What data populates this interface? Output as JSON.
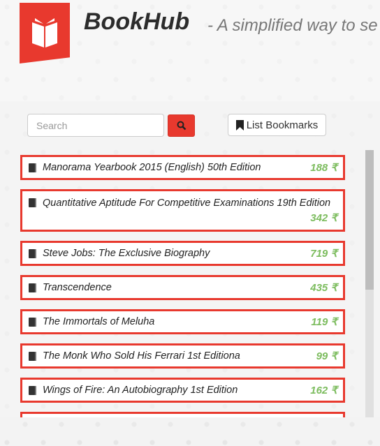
{
  "header": {
    "title": "BookHub",
    "subtitle": "- A simplified way to se"
  },
  "search": {
    "placeholder": "Search",
    "value": ""
  },
  "toolbar": {
    "bookmarks_label": "List Bookmarks"
  },
  "colors": {
    "accent": "#e8392e",
    "price": "#7cbc5e"
  },
  "books": [
    {
      "name": "Manorama Yearbook 2015 (English) 50th Edition",
      "price": "188 ₹"
    },
    {
      "name": "Quantitative Aptitude For Competitive Examinations 19th Edition",
      "price": "342 ₹"
    },
    {
      "name": "Steve Jobs: The Exclusive Biography",
      "price": "719 ₹"
    },
    {
      "name": "Transcendence",
      "price": "435 ₹"
    },
    {
      "name": "The Immortals of Meluha",
      "price": "119 ₹"
    },
    {
      "name": "The Monk Who Sold His Ferrari 1st Editiona",
      "price": "99 ₹"
    },
    {
      "name": "Wings of Fire: An Autobiography 1st Edition",
      "price": "162 ₹"
    }
  ]
}
